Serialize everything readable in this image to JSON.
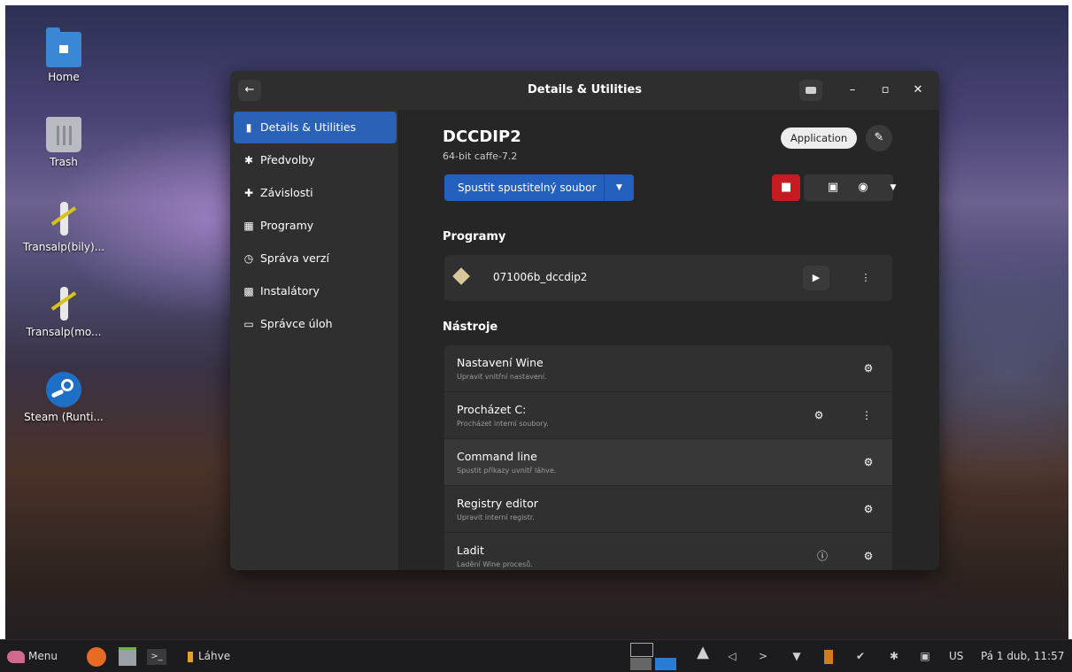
{
  "desktop": {
    "icons": [
      {
        "label": "Home",
        "icon": "home-folder-icon"
      },
      {
        "label": "Trash",
        "icon": "trash-icon"
      },
      {
        "label": "Transalp(bily)...",
        "icon": "transalp-icon"
      },
      {
        "label": "Transalp(mo...",
        "icon": "transalp-icon"
      },
      {
        "label": "Steam (Runti...",
        "icon": "steam-icon"
      }
    ]
  },
  "window": {
    "title": "Details & Utilities",
    "controls": {
      "back": "←",
      "minimize": "–",
      "maximize": "▫",
      "close": "✕"
    },
    "sidebar": [
      {
        "label": "Details & Utilities",
        "icon": "bottle-icon",
        "glyph": "▮",
        "active": true
      },
      {
        "label": "Předvolby",
        "icon": "gear-icon",
        "glyph": "✱"
      },
      {
        "label": "Závislosti",
        "icon": "puzzle-icon",
        "glyph": "✚"
      },
      {
        "label": "Programy",
        "icon": "grid-icon",
        "glyph": "▦"
      },
      {
        "label": "Správa verzí",
        "icon": "history-icon",
        "glyph": "◷"
      },
      {
        "label": "Instalátory",
        "icon": "installers-icon",
        "glyph": "▩"
      },
      {
        "label": "Správce úloh",
        "icon": "monitor-icon",
        "glyph": "▭"
      }
    ],
    "bottle": {
      "name": "DCCDIP2",
      "subtitle": "64-bit caffe-7.2",
      "badge": "Application",
      "run_button": "Spustit spustitelný soubor"
    },
    "programs_heading": "Programy",
    "programs": [
      {
        "name": "071006b_dccdip2"
      }
    ],
    "tools_heading": "Nástroje",
    "tools": [
      {
        "name": "Nastavení Wine",
        "desc": "Upravit vnitřní nastavení."
      },
      {
        "name": "Procházet C:",
        "desc": "Procházet interní soubory."
      },
      {
        "name": "Command line",
        "desc": "Spustit příkazy uvnitř láhve."
      },
      {
        "name": "Registry editor",
        "desc": "Upravit interní registr."
      },
      {
        "name": "Ladit",
        "desc": "Ladění Wine procesů."
      }
    ]
  },
  "taskbar": {
    "menu": "Menu",
    "task": "Láhve",
    "layout": "US",
    "clock": "Pá 1 dub, 11:57"
  },
  "colors": {
    "accent": "#2460bd",
    "danger": "#c51c22",
    "window_bg": "#262626",
    "sidebar_bg": "#2f2f2f"
  }
}
